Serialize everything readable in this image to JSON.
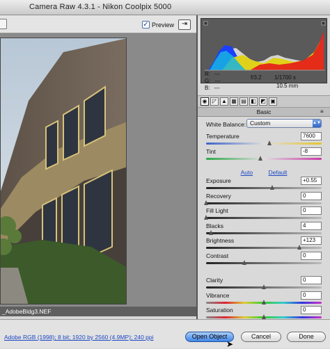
{
  "window": {
    "title": "Camera Raw 4.3.1  -  Nikon Coolpix 5000"
  },
  "toolbar": {
    "preview_label": "Preview",
    "preview_checked": "✓",
    "fullscreen_glyph": "⇥"
  },
  "image": {
    "filename": "_AdobeBldg3.NEF"
  },
  "readout": {
    "r_label": "R:",
    "r_value": "---",
    "g_label": "G:",
    "g_value": "---",
    "b_label": "B:",
    "b_value": "---",
    "aperture": "f/3.2",
    "shutter": "1/1700 s",
    "focal": "10.5 mm"
  },
  "panel": {
    "title": "Basic",
    "menu_glyph": "≡"
  },
  "white_balance": {
    "label": "White Balance:",
    "value": "Custom"
  },
  "sliders_top": [
    {
      "label": "Temperature",
      "value": "7600",
      "level": 0.55
    },
    {
      "label": "Tint",
      "value": "-8",
      "level": 0.47
    }
  ],
  "auto_label": "Auto",
  "default_label": "Default",
  "sliders_tone": [
    {
      "label": "Exposure",
      "value": "+0.55",
      "level": 0.57
    },
    {
      "label": "Recovery",
      "value": "0",
      "level": 0.0
    },
    {
      "label": "Fill Light",
      "value": "0",
      "level": 0.0
    },
    {
      "label": "Blacks",
      "value": "4",
      "level": 0.04
    },
    {
      "label": "Brightness",
      "value": "+123",
      "level": 0.81
    },
    {
      "label": "Contrast",
      "value": "0",
      "level": 0.33
    }
  ],
  "sliders_presence": [
    {
      "label": "Clarity",
      "value": "0",
      "level": 0.5
    },
    {
      "label": "Vibrance",
      "value": "0",
      "level": 0.5
    },
    {
      "label": "Saturation",
      "value": "0",
      "level": 0.5
    }
  ],
  "bottom": {
    "workflow_link": "Adobe RGB (1998); 8 bit; 1920 by 2560 (4.9MP); 240 ppi",
    "open_label": "Open Object",
    "cancel_label": "Cancel",
    "done_label": "Done"
  },
  "colors": {
    "accent": "#3f86e6",
    "link": "#1d48c4"
  }
}
